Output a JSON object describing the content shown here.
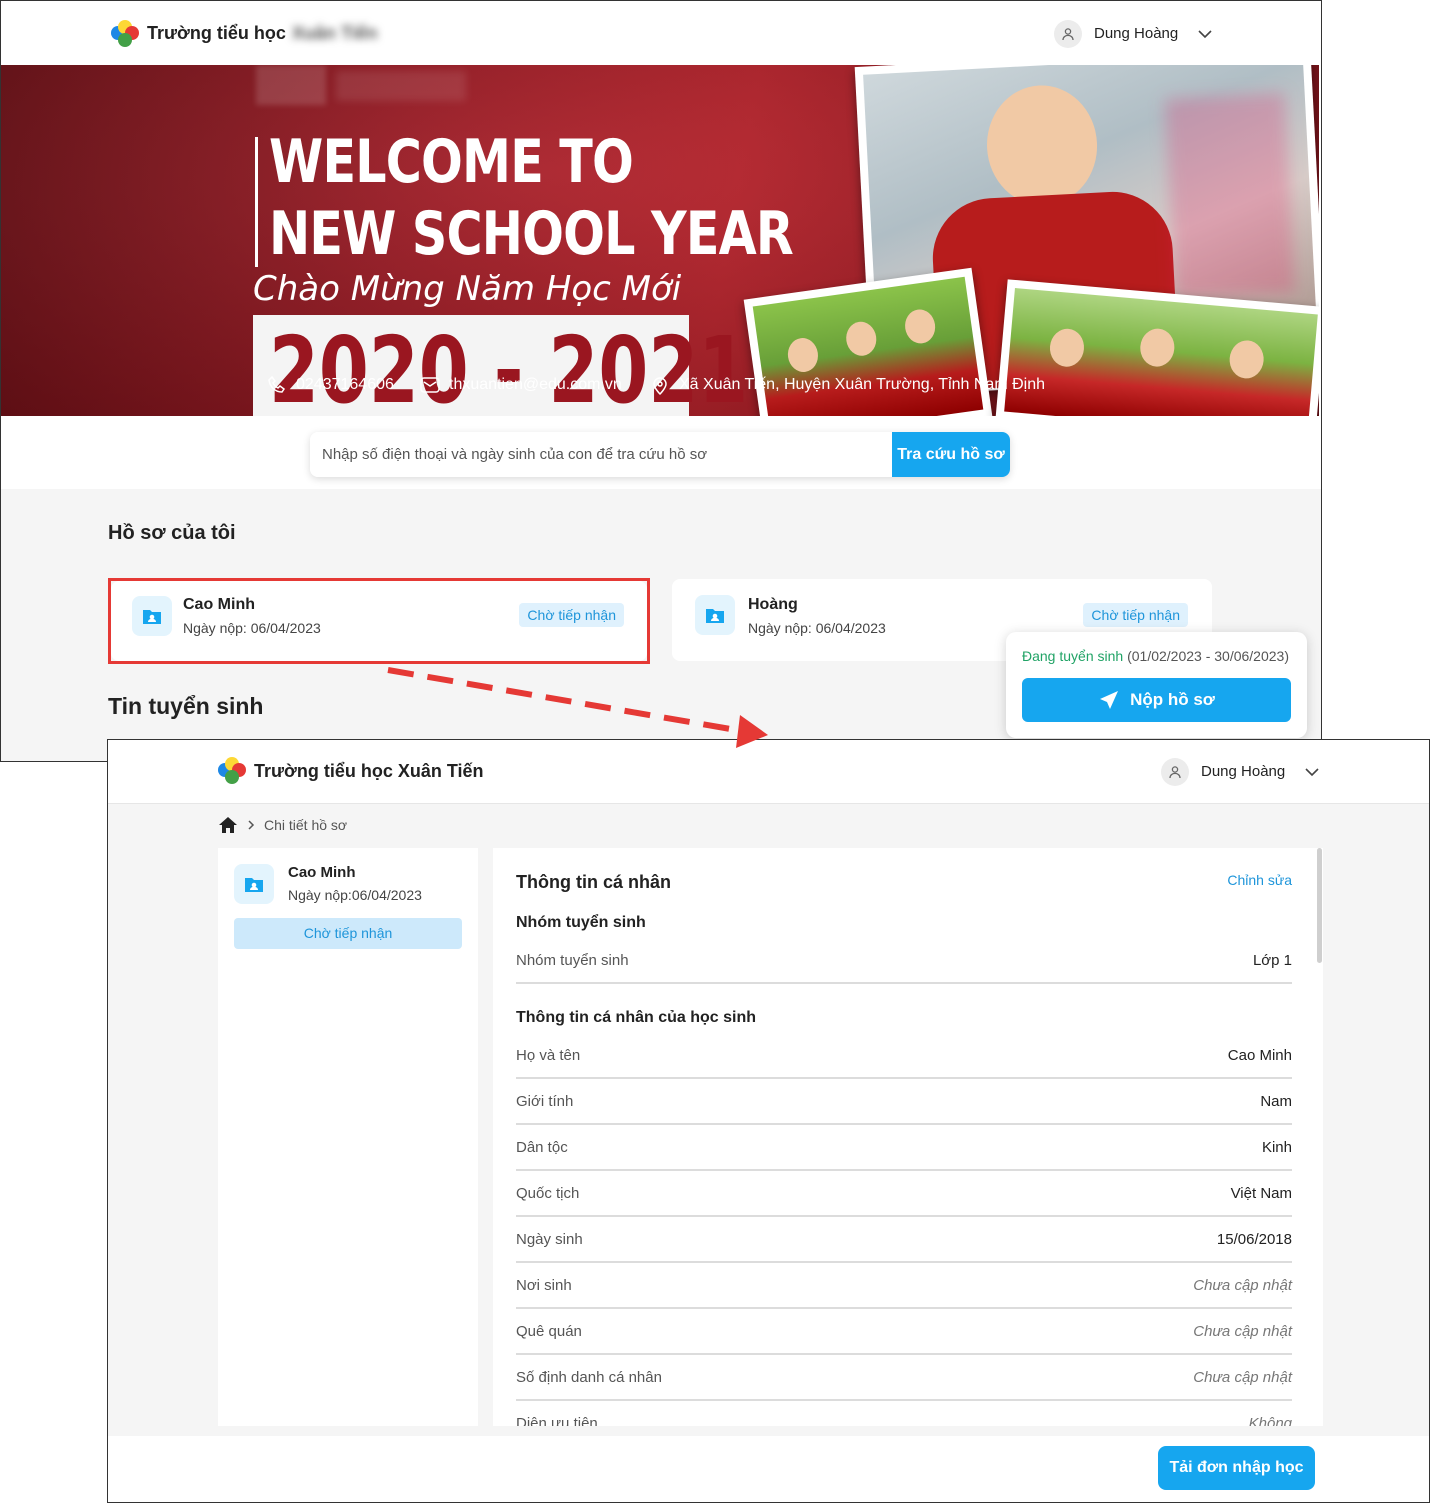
{
  "top": {
    "header": {
      "school_name": "Trường tiểu học",
      "school_name_blurred": "Xuân Tiến",
      "user_name": "Dung Hoàng"
    },
    "banner": {
      "welcome_line1": "WELCOME TO",
      "welcome_line2": "NEW SCHOOL YEAR",
      "subtitle": "Chào Mừng Năm Học Mới",
      "year": "2020 - 2021",
      "phone": "02437164606",
      "email": "thxuantien@edu.com.vn",
      "address": "Xã Xuân Tiến, Huyện Xuân Trường, Tỉnh Nam Định"
    },
    "search": {
      "placeholder": "Nhập số điện thoại và ngày sinh của con để tra cứu hồ sơ",
      "button": "Tra cứu hồ sơ"
    },
    "my_profiles": {
      "title": "Hồ sơ của tôi",
      "cards": [
        {
          "name": "Cao Minh",
          "date": "Ngày nộp: 06/04/2023",
          "status": "Chờ tiếp nhận"
        },
        {
          "name": "Hoàng",
          "date": "Ngày nộp: 06/04/2023",
          "status": "Chờ tiếp nhận"
        }
      ]
    },
    "news_title": "Tin tuyển sinh",
    "popup": {
      "status": "Đang tuyển sinh",
      "period": "(01/02/2023 - 30/06/2023)",
      "button": "Nộp hồ sơ"
    }
  },
  "bottom": {
    "header": {
      "school_name": "Trường tiểu học Xuân Tiến",
      "user_name": "Dung Hoàng"
    },
    "breadcrumb": {
      "current": "Chi tiết hồ sơ"
    },
    "profile": {
      "name": "Cao Minh",
      "date_label": "Ngày nộp:",
      "date": "06/04/2023",
      "status": "Chờ tiếp nhận"
    },
    "details": {
      "title": "Thông tin cá nhân",
      "edit": "Chỉnh sửa",
      "group_title": "Nhóm tuyển sinh",
      "group_rows": [
        {
          "label": "Nhóm tuyển sinh",
          "value": "Lớp 1"
        }
      ],
      "student_title": "Thông tin cá nhân của học sinh",
      "student_rows": [
        {
          "label": "Họ và tên",
          "value": "Cao Minh"
        },
        {
          "label": "Giới tính",
          "value": "Nam"
        },
        {
          "label": "Dân tộc",
          "value": "Kinh"
        },
        {
          "label": "Quốc tịch",
          "value": "Việt Nam"
        },
        {
          "label": "Ngày sinh",
          "value": "15/06/2018"
        },
        {
          "label": "Nơi sinh",
          "value": "Chưa cập nhật"
        },
        {
          "label": "Quê quán",
          "value": "Chưa cập nhật"
        },
        {
          "label": "Số định danh cá nhân",
          "value": "Chưa cập nhật"
        },
        {
          "label": "Diện ưu tiên",
          "value": "Không"
        }
      ]
    },
    "footer": {
      "button": "Tải đơn nhập học"
    }
  },
  "colors": {
    "primary": "#16a6ef",
    "badge_bg": "#dff1fd",
    "highlight": "#e53935",
    "active_green": "#21a366",
    "banner_red": "#9a1620"
  }
}
